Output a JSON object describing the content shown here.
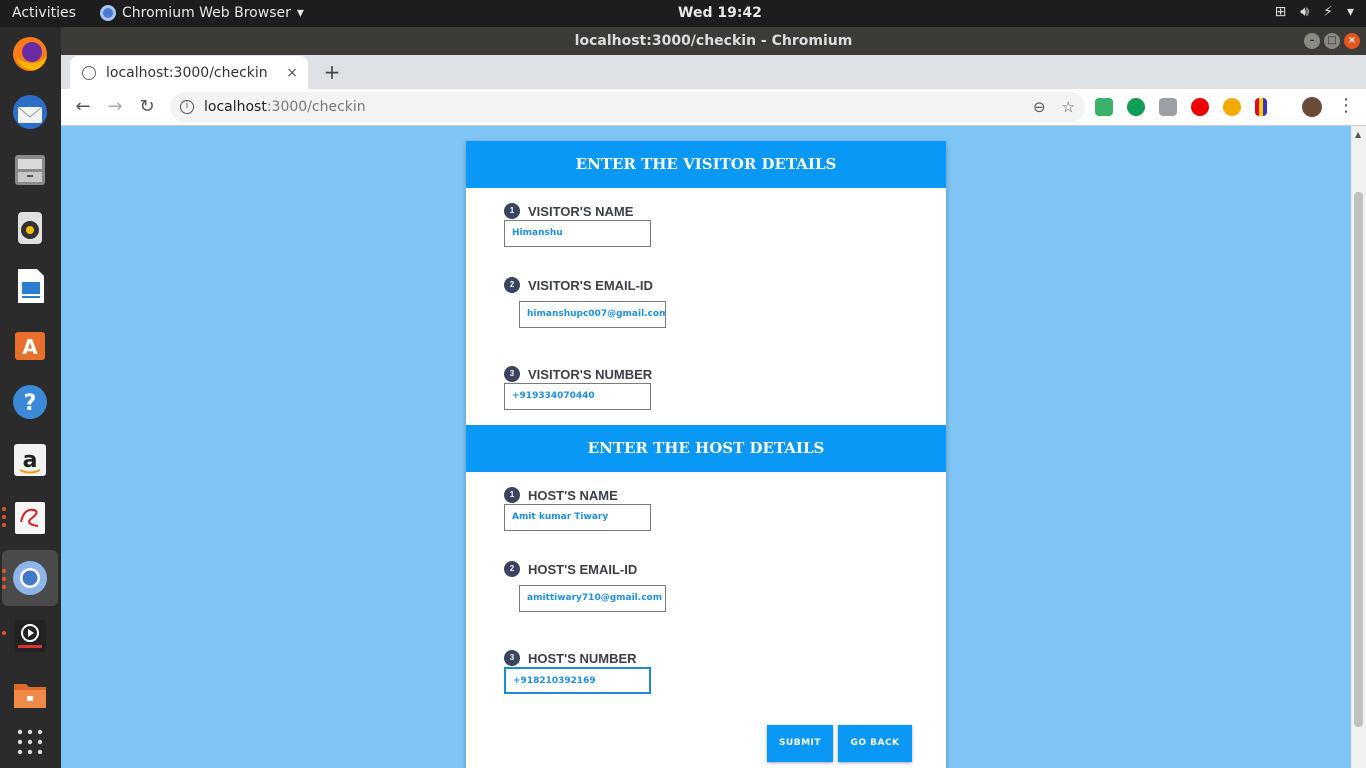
{
  "topbar": {
    "activities": "Activities",
    "app_name": "Chromium Web Browser",
    "clock": "Wed 19:42",
    "tray_icons": [
      "network-icon",
      "volume-icon",
      "battery-icon",
      "power-menu-icon"
    ]
  },
  "dock": {
    "apps": [
      "firefox",
      "thunderbird",
      "files-cabinet",
      "rhythmbox",
      "libreoffice-writer",
      "ubuntu-software",
      "help",
      "amazon",
      "evince",
      "chromium",
      "video-player",
      "file-manager",
      "show-applications"
    ]
  },
  "window": {
    "title": "localhost:3000/checkin - Chromium"
  },
  "tab": {
    "label": "localhost:3000/checkin",
    "close": "×",
    "new_tab": "+"
  },
  "omnibox": {
    "host": "localhost",
    "path": ":3000/checkin"
  },
  "form": {
    "visitor_header": "ENTER THE VISITOR DETAILS",
    "host_header": "ENTER THE HOST DETAILS",
    "visitor_fields": [
      {
        "step": "1",
        "label": "VISITOR'S NAME",
        "value": "Himanshu"
      },
      {
        "step": "2",
        "label": "VISITOR'S EMAIL-ID",
        "value": "himanshupc007@gmail.com"
      },
      {
        "step": "3",
        "label": "VISITOR'S NUMBER",
        "value": "+919334070440"
      }
    ],
    "host_fields": [
      {
        "step": "1",
        "label": "HOST'S NAME",
        "value": "Amit kumar Tiwary"
      },
      {
        "step": "2",
        "label": "HOST'S EMAIL-ID",
        "value": "amittiwary710@gmail.com"
      },
      {
        "step": "3",
        "label": "HOST'S NUMBER",
        "value": "+918210392169"
      }
    ],
    "submit_label": "SUBMIT",
    "go_back_label": "GO BACK"
  }
}
